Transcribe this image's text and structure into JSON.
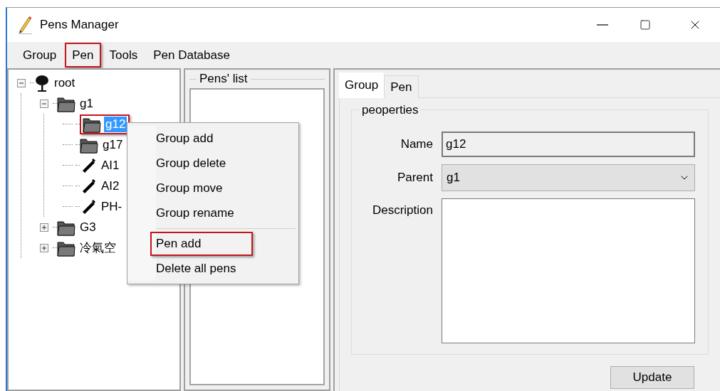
{
  "window": {
    "title": "Pens Manager"
  },
  "menu": [
    {
      "label": "Group",
      "highlighted": false
    },
    {
      "label": "Pen",
      "highlighted": true
    },
    {
      "label": "Tools",
      "highlighted": false
    },
    {
      "label": "Pen Database",
      "highlighted": false
    }
  ],
  "tree": [
    {
      "label": "root",
      "kind": "root",
      "expanded": true,
      "selected": false,
      "highlighted": false,
      "children": [
        {
          "label": "g1",
          "kind": "folder",
          "expanded": true,
          "selected": false,
          "highlighted": false,
          "children": [
            {
              "label": "g12",
              "kind": "folder",
              "selected": true,
              "highlighted": true
            },
            {
              "label": "g17",
              "kind": "folder",
              "selected": false,
              "highlighted": false
            },
            {
              "label": "AI1",
              "kind": "pen",
              "selected": false,
              "highlighted": false
            },
            {
              "label": "AI2",
              "kind": "pen",
              "selected": false,
              "highlighted": false
            },
            {
              "label": "PH-",
              "kind": "pen",
              "selected": false,
              "highlighted": false
            }
          ]
        },
        {
          "label": "G3",
          "kind": "folder",
          "expanded": false,
          "selected": false,
          "highlighted": false
        },
        {
          "label": "冷氣空",
          "kind": "folder",
          "expanded": false,
          "selected": false,
          "highlighted": false
        }
      ]
    }
  ],
  "pens_list": {
    "title": "Pens' list"
  },
  "context_menu": [
    {
      "label": "Group add",
      "kind": "item",
      "highlighted": false
    },
    {
      "label": "Group delete",
      "kind": "item",
      "highlighted": false
    },
    {
      "label": "Group move",
      "kind": "item",
      "highlighted": false
    },
    {
      "label": "Group rename",
      "kind": "item",
      "highlighted": false
    },
    {
      "kind": "separator"
    },
    {
      "label": "Pen add",
      "kind": "item",
      "highlighted": true
    },
    {
      "label": "Delete all pens",
      "kind": "item",
      "highlighted": false
    }
  ],
  "tabs": [
    {
      "label": "Group",
      "selected": true
    },
    {
      "label": "Pen",
      "selected": false
    }
  ],
  "properties": {
    "title": "peoperties",
    "name_label": "Name",
    "name_value": "g12",
    "parent_label": "Parent",
    "parent_value": "g1",
    "description_label": "Description"
  },
  "update_button": "Update"
}
